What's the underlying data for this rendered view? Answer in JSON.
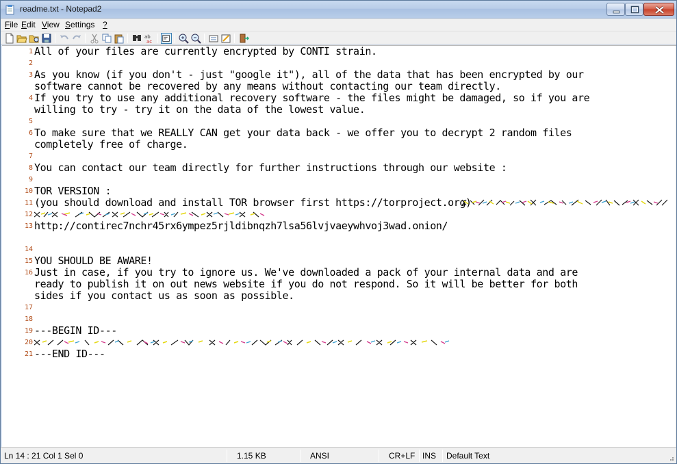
{
  "window": {
    "title": "readme.txt - Notepad2"
  },
  "menu": {
    "file": "File",
    "edit": "Edit",
    "view": "View",
    "settings": "Settings",
    "help": "?"
  },
  "toolbar": {
    "buttons": [
      "new",
      "open",
      "browse",
      "save",
      "undo",
      "redo",
      "cut",
      "copy",
      "paste",
      "find",
      "replace",
      "word-wrap",
      "zoom-in",
      "zoom-out",
      "select-scheme",
      "customize-schemes",
      "exit"
    ]
  },
  "editor": {
    "lines": [
      {
        "n": "1",
        "text": "All of your files are currently encrypted by CONTI strain."
      },
      {
        "n": "2",
        "text": ""
      },
      {
        "n": "3",
        "text": "As you know (if you don't - just \"google it\"), all of the data that has been encrypted by our"
      },
      {
        "n": "",
        "text": "software cannot be recovered by any means without contacting our team directly."
      },
      {
        "n": "4",
        "text": "If you try to use any additional recovery software - the files might be damaged, so if you are"
      },
      {
        "n": "",
        "text": "willing to try - try it on the data of the lowest value."
      },
      {
        "n": "5",
        "text": ""
      },
      {
        "n": "6",
        "text": "To make sure that we REALLY CAN get your data back - we offer you to decrypt 2 random files"
      },
      {
        "n": "",
        "text": "completely free of charge."
      },
      {
        "n": "7",
        "text": ""
      },
      {
        "n": "8",
        "text": "You can contact our team directly for further instructions through our website :"
      },
      {
        "n": "9",
        "text": ""
      },
      {
        "n": "10",
        "text": "TOR VERSION :"
      },
      {
        "n": "11",
        "text": "(you should download and install TOR browser first https://torproject.org)"
      },
      {
        "n": "12",
        "text": ""
      },
      {
        "n": "13",
        "text": "http://contirec7nchr45rx6ympez5rjldibnqzh7lsa56lvjvaeywhvoj3wad.onion/"
      },
      {
        "n": "",
        "text": ""
      },
      {
        "n": "14",
        "text": ""
      },
      {
        "n": "15",
        "text": "YOU SHOULD BE AWARE!"
      },
      {
        "n": "16",
        "text": "Just in case, if you try to ignore us. We've downloaded a pack of your internal data and are"
      },
      {
        "n": "",
        "text": "ready to publish it on out news website if you do not respond. So it will be better for both"
      },
      {
        "n": "",
        "text": "sides if you contact us as soon as possible."
      },
      {
        "n": "17",
        "text": ""
      },
      {
        "n": "18",
        "text": ""
      },
      {
        "n": "19",
        "text": "---BEGIN ID---"
      },
      {
        "n": "20",
        "text": ""
      },
      {
        "n": "21",
        "text": "---END ID---"
      }
    ]
  },
  "status": {
    "position": "Ln 14 : 21   Col 1   Sel 0",
    "size": "1.15 KB",
    "encoding": "ANSI",
    "line_endings": "CR+LF",
    "mode": "INS",
    "scheme": "Default Text"
  }
}
